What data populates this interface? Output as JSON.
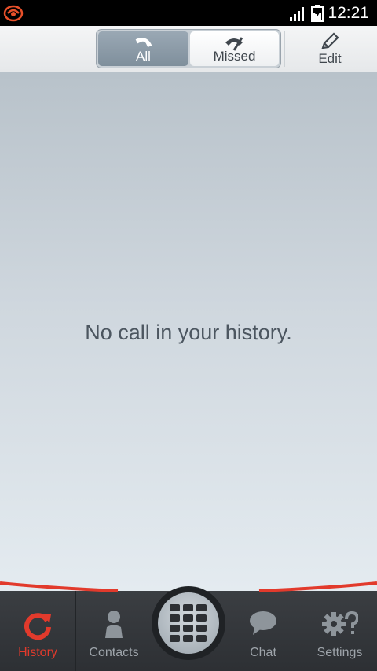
{
  "status_bar": {
    "time": "12:21",
    "icons": [
      "app-notification-icon",
      "signal-icon",
      "battery-icon"
    ]
  },
  "toolbar": {
    "segments": [
      {
        "label": "All",
        "icon": "phone-icon",
        "selected": true
      },
      {
        "label": "Missed",
        "icon": "missed-call-icon",
        "selected": false
      }
    ],
    "edit_label": "Edit",
    "edit_icon": "pencil-icon"
  },
  "main": {
    "empty_message": "No call in your history."
  },
  "bottom_nav": {
    "items": [
      {
        "label": "History",
        "icon": "history-icon",
        "active": true
      },
      {
        "label": "Contacts",
        "icon": "contacts-icon",
        "active": false
      },
      {
        "label": "",
        "icon": "dialpad-icon",
        "active": false
      },
      {
        "label": "Chat",
        "icon": "chat-icon",
        "active": false
      },
      {
        "label": "Settings",
        "icon": "settings-icon",
        "active": false
      }
    ]
  },
  "colors": {
    "accent": "#e23a2c",
    "nav_bg": "#33363a",
    "content_top": "#b8c2ca",
    "content_bottom": "#e4ebf0"
  }
}
